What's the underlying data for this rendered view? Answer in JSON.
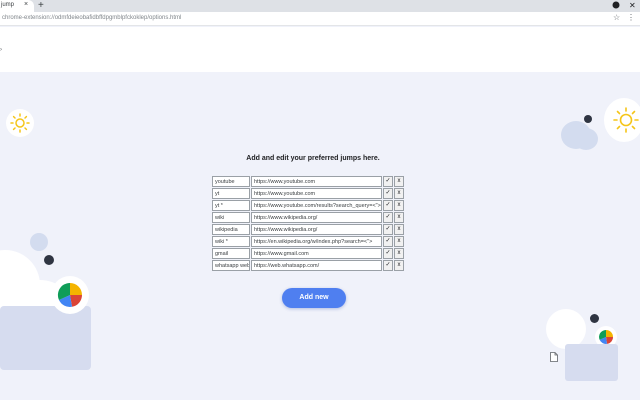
{
  "browser": {
    "tab_title": "jump",
    "tab_close": "×",
    "new_tab": "+",
    "url_scheme": "chrome-extension://",
    "url_path": "odmfdeieobafidbffdpgmblpfckoklep/options.html"
  },
  "heading": "Add and edit your preferred jumps here.",
  "jumps": [
    {
      "name": "youtube",
      "url": "https://www.youtube.com"
    },
    {
      "name": "yt",
      "url": "https://www.youtube.com"
    },
    {
      "name": "yt *",
      "url": "https://www.youtube.com/results?search_query=<\">"
    },
    {
      "name": "wiki",
      "url": "https://www.wikipedia.org/"
    },
    {
      "name": "wikipedia",
      "url": "https://www.wikipedia.org/"
    },
    {
      "name": "wiki *",
      "url": "https://en.wikipedia.org/w/index.php?search=<\">"
    },
    {
      "name": "gmail",
      "url": "https://www.gmail.com"
    },
    {
      "name": "whatsapp web",
      "url": "https://web.whatsapp.com/"
    }
  ],
  "row_buttons": {
    "confirm": "✓",
    "delete": "x"
  },
  "add_new_label": "Add new",
  "icons": {
    "star": "star-icon",
    "menu": "menu-icon",
    "sun": "sun-icon",
    "document": "document-icon",
    "pie_chart": "pie-chart-icon"
  },
  "colors": {
    "accent": "#4f7ff0",
    "background": "#f0f2fa",
    "sun": "#f5c518"
  }
}
